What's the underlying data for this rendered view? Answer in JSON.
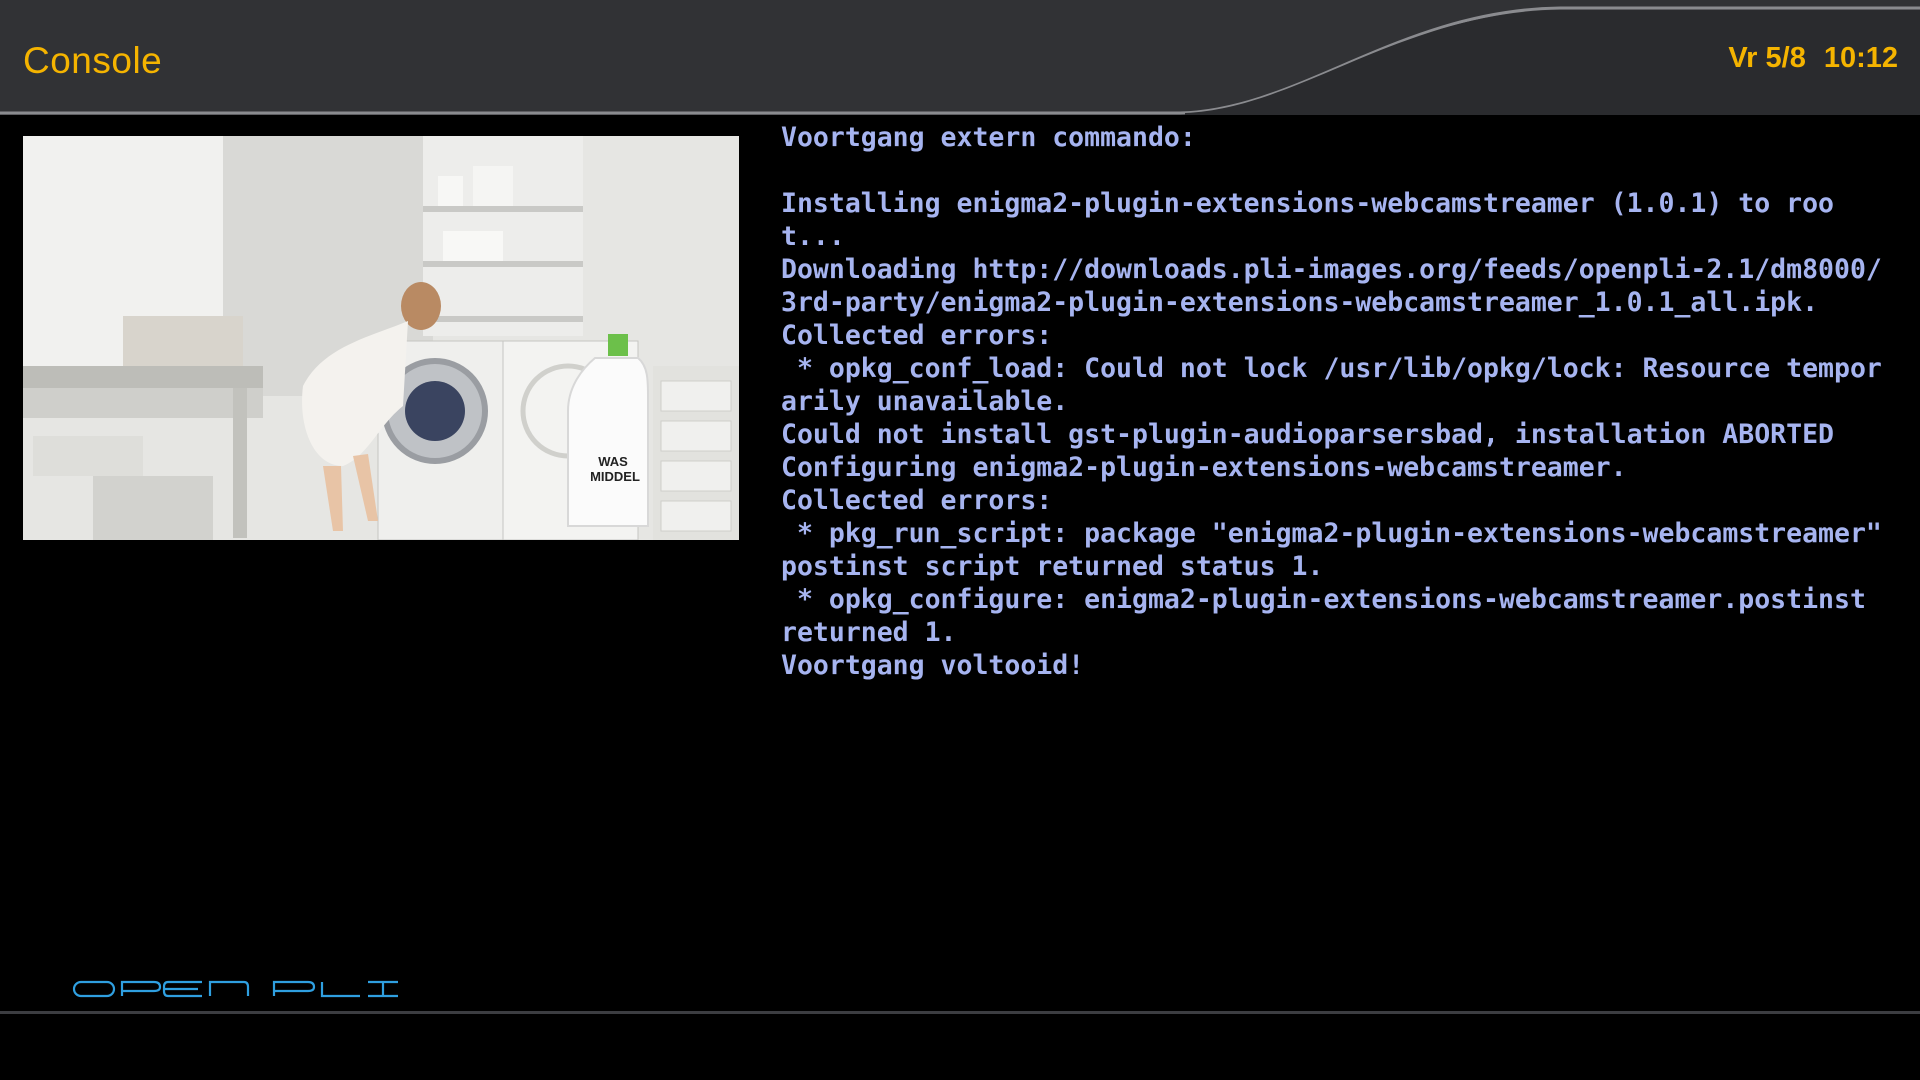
{
  "header": {
    "title": "Console",
    "date": "Vr 5/8",
    "time": "10:12"
  },
  "pip": {
    "bottle_label_line1": "WAS",
    "bottle_label_line2": "MIDDEL"
  },
  "console": {
    "lines": [
      "Voortgang extern commando:",
      "",
      "Installing enigma2-plugin-extensions-webcamstreamer (1.0.1) to root...",
      "Downloading http://downloads.pli-images.org/feeds/openpli-2.1/dm8000/3rd-party/enigma2-plugin-extensions-webcamstreamer_1.0.1_all.ipk.",
      "Collected errors:",
      " * opkg_conf_load: Could not lock /usr/lib/opkg/lock: Resource temporarily unavailable.",
      "Could not install gst-plugin-audioparsersbad, installation ABORTED",
      "Configuring enigma2-plugin-extensions-webcamstreamer.",
      "Collected errors:",
      " * pkg_run_script: package \"enigma2-plugin-extensions-webcamstreamer\" postinst script returned status 1.",
      " * opkg_configure: enigma2-plugin-extensions-webcamstreamer.postinst returned 1.",
      "Voortgang voltooid!"
    ]
  },
  "logo": {
    "text": "OPEN PLI",
    "color": "#2f9fe0"
  },
  "colors": {
    "accent": "#f5b400",
    "console_text": "#a6b4f0",
    "header_bg": "#313235"
  }
}
